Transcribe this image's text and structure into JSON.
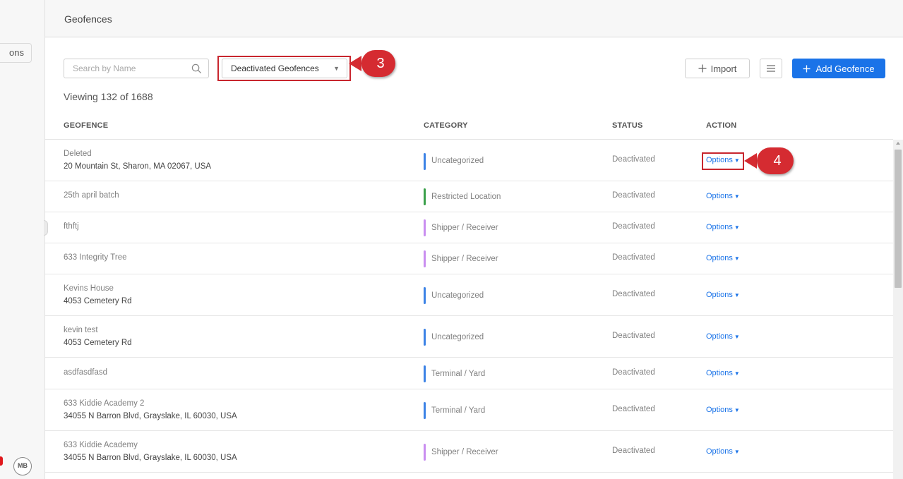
{
  "sidebar": {
    "item_partial": "ons",
    "avatar": "MB"
  },
  "header": {
    "title": "Geofences"
  },
  "toolbar": {
    "search_placeholder": "Search by Name",
    "filter_value": "Deactivated Geofences",
    "import_label": "Import",
    "add_label": "Add Geofence"
  },
  "viewing": "Viewing 132 of 1688",
  "annotations": {
    "callout_3": "3",
    "callout_4": "4",
    "color": "#d52b31"
  },
  "table": {
    "headers": {
      "geofence": "GEOFENCE",
      "category": "CATEGORY",
      "status": "STATUS",
      "action": "ACTION"
    },
    "options_label": "Options",
    "rows": [
      {
        "name": "Deleted",
        "address": "20 Mountain St, Sharon, MA 02067, USA",
        "category": "Uncategorized",
        "category_color": "#3b82e6",
        "status": "Deactivated"
      },
      {
        "name": "25th april batch",
        "address": "",
        "category": "Restricted Location",
        "category_color": "#3aa04a",
        "status": "Deactivated"
      },
      {
        "name": "fthftj",
        "address": "",
        "category": "Shipper / Receiver",
        "category_color": "#c98ef0",
        "status": "Deactivated"
      },
      {
        "name": "633 Integrity Tree",
        "address": "",
        "category": "Shipper / Receiver",
        "category_color": "#c98ef0",
        "status": "Deactivated"
      },
      {
        "name": "Kevins House",
        "address": "4053 Cemetery Rd",
        "category": "Uncategorized",
        "category_color": "#3b82e6",
        "status": "Deactivated"
      },
      {
        "name": "kevin test",
        "address": "4053 Cemetery Rd",
        "category": "Uncategorized",
        "category_color": "#3b82e6",
        "status": "Deactivated"
      },
      {
        "name": "asdfasdfasd",
        "address": "",
        "category": "Terminal / Yard",
        "category_color": "#3b82e6",
        "status": "Deactivated"
      },
      {
        "name": "633 Kiddie Academy 2",
        "address": "34055 N Barron Blvd, Grayslake, IL 60030, USA",
        "category": "Terminal / Yard",
        "category_color": "#3b82e6",
        "status": "Deactivated"
      },
      {
        "name": "633 Kiddie Academy",
        "address": "34055 N Barron Blvd, Grayslake, IL 60030, USA",
        "category": "Shipper / Receiver",
        "category_color": "#c98ef0",
        "status": "Deactivated"
      }
    ]
  }
}
